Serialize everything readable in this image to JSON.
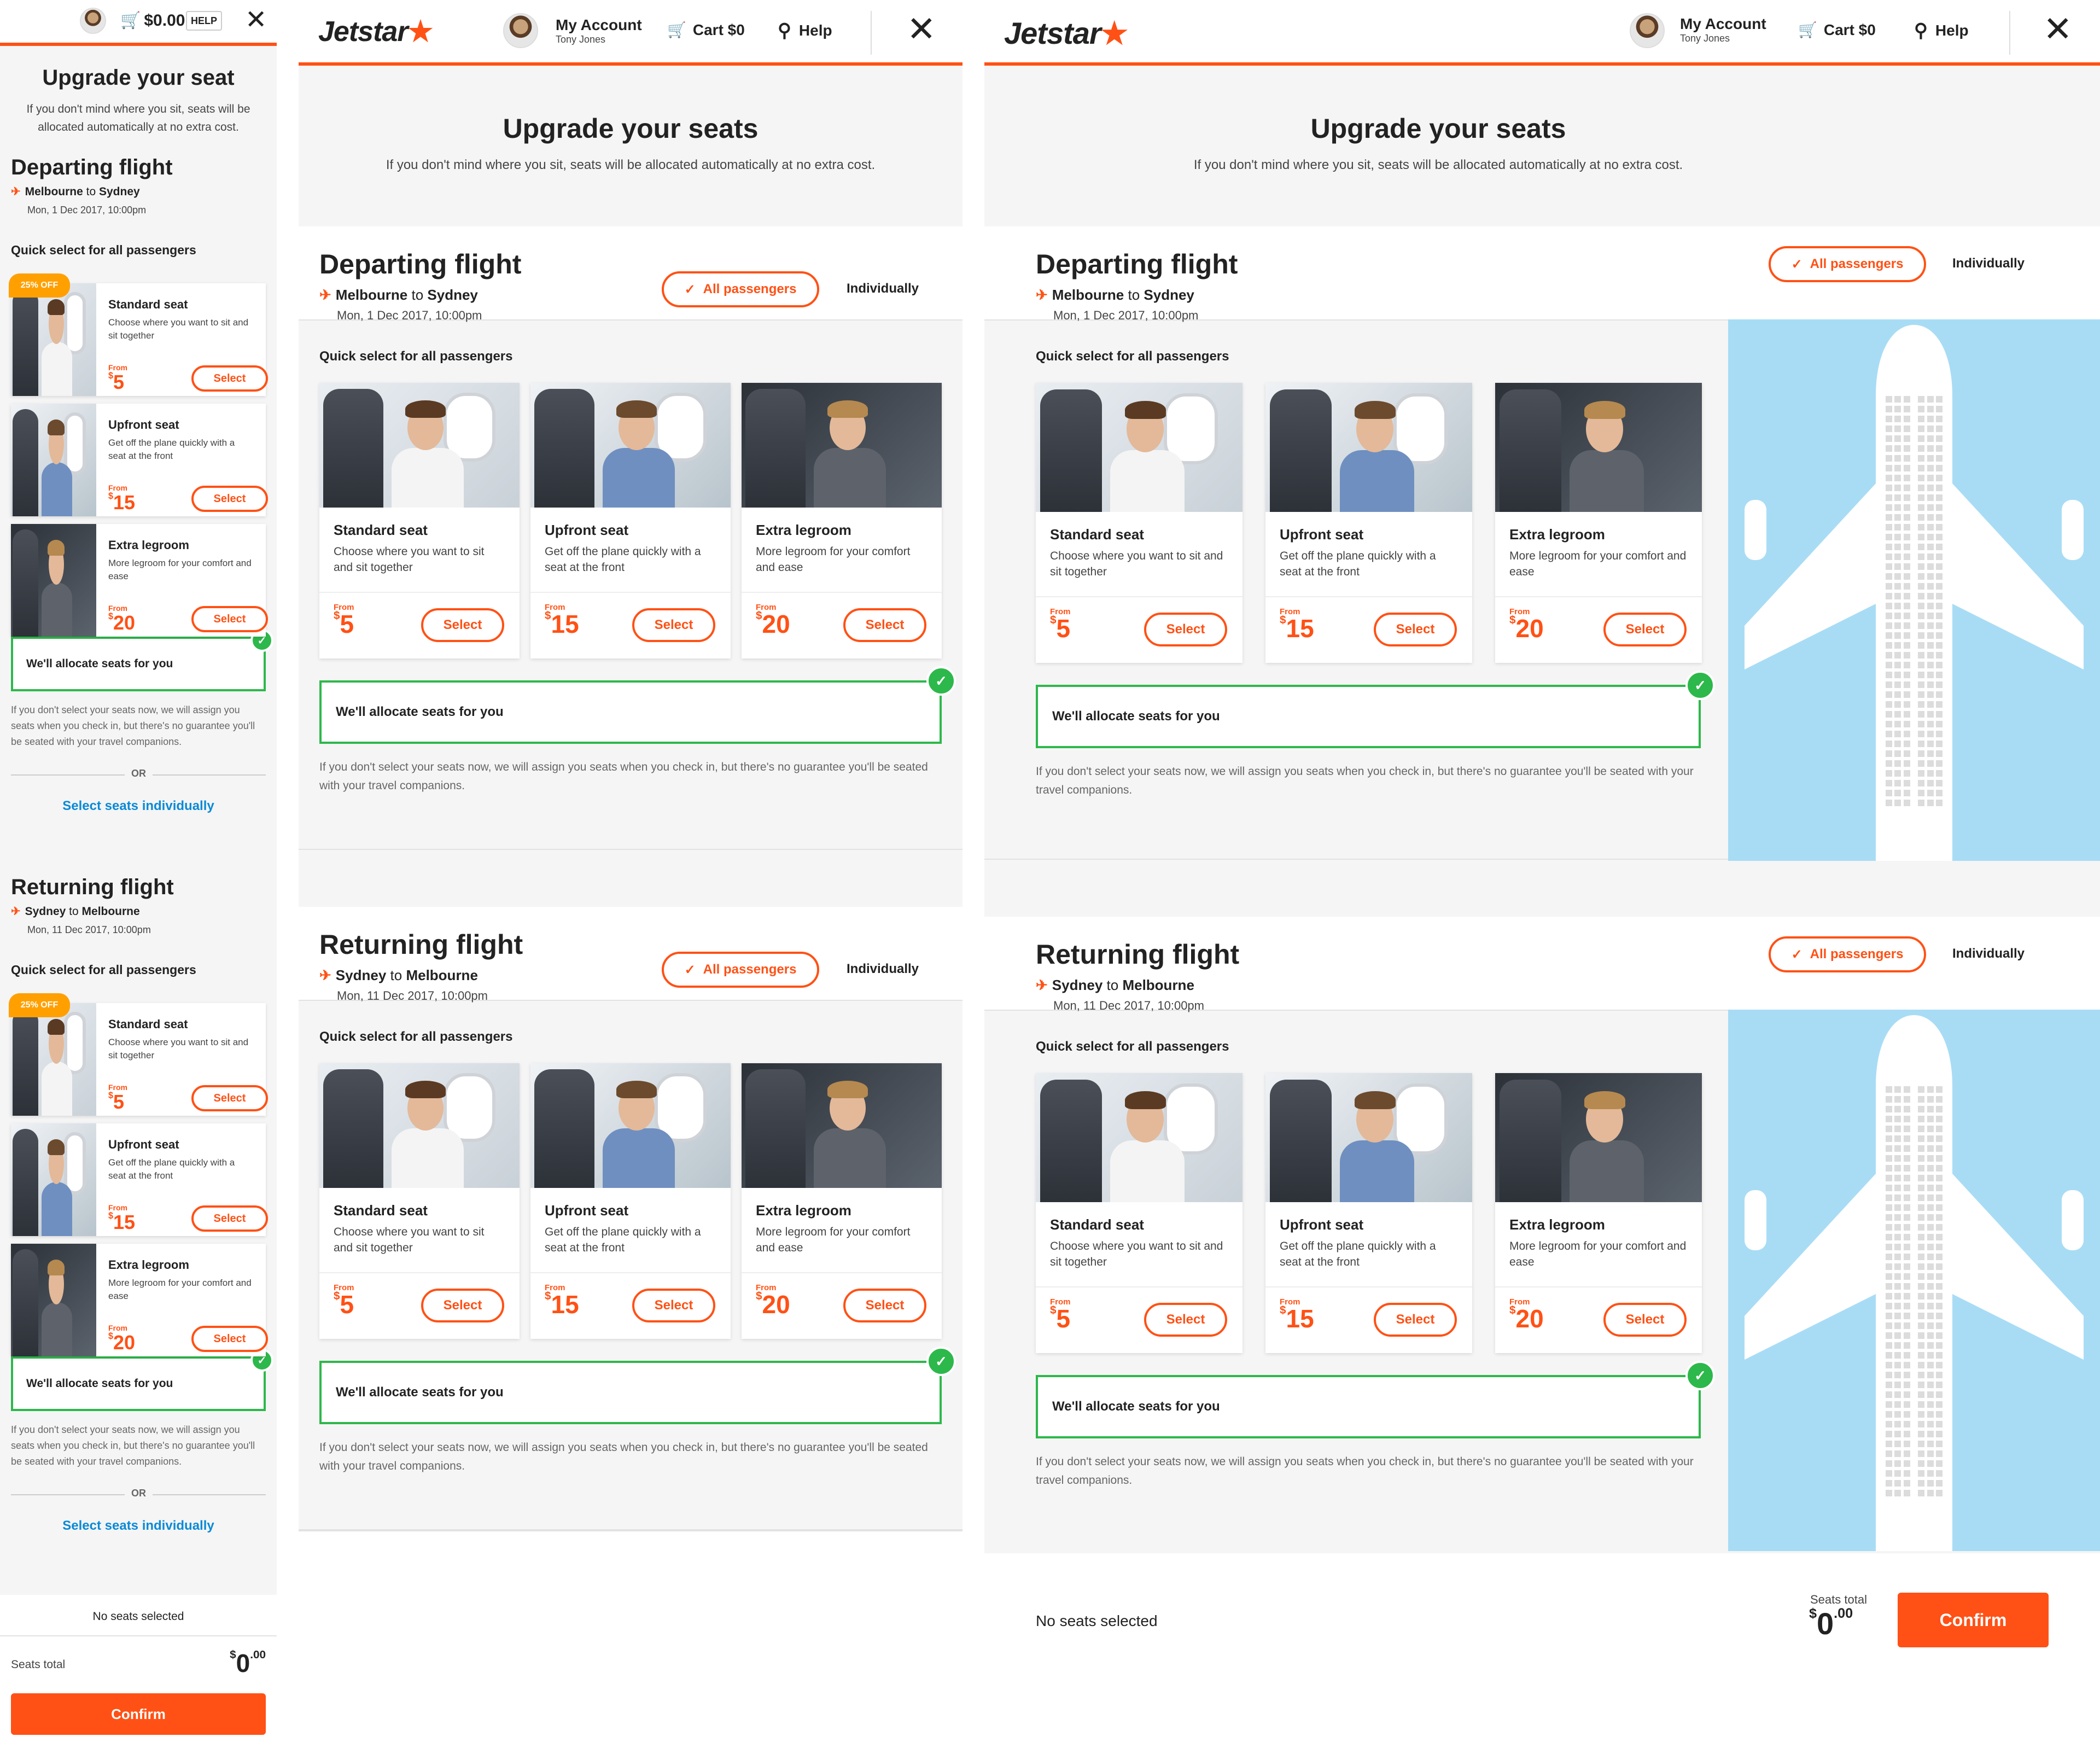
{
  "brand": {
    "name": "Jetstar",
    "accent": "#ff5115",
    "success": "#2db84b",
    "link": "#0a8ad6",
    "badge": "#ffa000"
  },
  "header": {
    "account_label": "My Account",
    "account_user": "Tony Jones",
    "cart_label": "Cart",
    "cart_amount": "$0",
    "help_label": "Help",
    "mobile_cart": "$0.00",
    "mobile_help": "HELP"
  },
  "page": {
    "title_plural": "Upgrade your seats",
    "title_singular": "Upgrade your seat",
    "subtitle": "If you don't mind where you sit, seats will be allocated automatically at no extra cost."
  },
  "toggle": {
    "all_passengers": "All passengers",
    "individually": "Individually"
  },
  "quick_select_label": "Quick select for all passengers",
  "flights": [
    {
      "title": "Departing flight",
      "from": "Melbourne",
      "to": "Sydney",
      "connector": "to",
      "date": "Mon, 1 Dec 2017, 10:00pm"
    },
    {
      "title": "Returning flight",
      "from": "Sydney",
      "to": "Melbourne",
      "connector": "to",
      "date": "Mon, 11 Dec 2017, 10:00pm"
    }
  ],
  "seat_options": [
    {
      "name": "Standard seat",
      "desc": "Choose where you want to sit and sit together",
      "from": "From",
      "currency": "$",
      "price": "5",
      "select": "Select"
    },
    {
      "name": "Upfront seat",
      "desc": "Get off the plane quickly with a seat at the front",
      "from": "From",
      "currency": "$",
      "price": "15",
      "select": "Select"
    },
    {
      "name": "Extra legroom",
      "desc": "More legroom for your comfort and ease",
      "from": "From",
      "currency": "$",
      "price": "20",
      "select": "Select"
    }
  ],
  "discount_badge": "25% OFF",
  "allocate": {
    "label": "We'll allocate seats for you",
    "note": "If you don't select your seats now, we will assign you seats when you check in, but there's no guarantee you'll be seated with your travel companions.",
    "or": "OR",
    "select_individually": "Select seats individually"
  },
  "footer": {
    "no_seats": "No seats selected",
    "seats_total_label": "Seats total",
    "total_currency": "$",
    "total_whole": "0",
    "total_cents": ".00",
    "confirm": "Confirm"
  },
  "icons": {
    "plane": "plane-icon",
    "cart": "cart-icon",
    "search": "search-icon",
    "close": "close-icon",
    "check": "check-icon"
  }
}
